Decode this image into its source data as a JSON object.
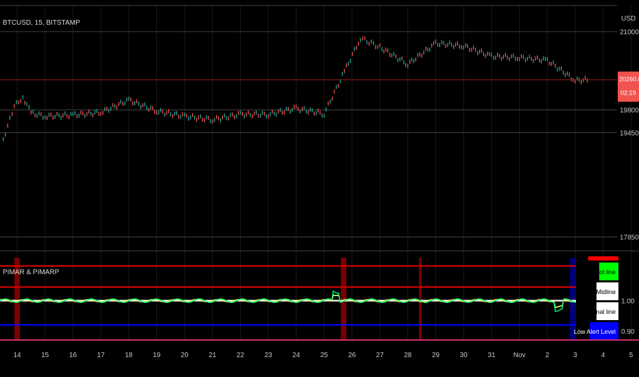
{
  "chart_data": [
    {
      "type": "candlestick",
      "title": "BTCUSD, 15, BITSTAMP",
      "ylabel": "USD",
      "x_ticks": [
        "14",
        "15",
        "16",
        "17",
        "18",
        "19",
        "20",
        "21",
        "22",
        "23",
        "24",
        "25",
        "26",
        "27",
        "28",
        "29",
        "30",
        "31",
        "Nov",
        "2",
        "3",
        "4",
        "5"
      ],
      "y_ticks": [
        21000.0,
        19800.0,
        19450.0,
        17850.0
      ],
      "ylim": [
        17700,
        21400
      ],
      "grid": true,
      "last_price": {
        "label": "20260.00",
        "countdown": "02:19",
        "color": "#f05350"
      },
      "series": [
        {
          "x": "13.5",
          "y": 19350
        },
        {
          "x": "13.9",
          "y": 19850
        },
        {
          "x": "14.2",
          "y": 20000
        },
        {
          "x": "14.5",
          "y": 19750
        },
        {
          "x": "15",
          "y": 19700
        },
        {
          "x": "16",
          "y": 19720
        },
        {
          "x": "17",
          "y": 19760
        },
        {
          "x": "18",
          "y": 19950
        },
        {
          "x": "19",
          "y": 19780
        },
        {
          "x": "20",
          "y": 19700
        },
        {
          "x": "21",
          "y": 19650
        },
        {
          "x": "22",
          "y": 19730
        },
        {
          "x": "23",
          "y": 19730
        },
        {
          "x": "24",
          "y": 19820
        },
        {
          "x": "25",
          "y": 19740
        },
        {
          "x": "25.8",
          "y": 20450
        },
        {
          "x": "26.3",
          "y": 20900
        },
        {
          "x": "27",
          "y": 20760
        },
        {
          "x": "28",
          "y": 20500
        },
        {
          "x": "29",
          "y": 20820
        },
        {
          "x": "30",
          "y": 20780
        },
        {
          "x": "31",
          "y": 20620
        },
        {
          "x": "Nov",
          "y": 20600
        },
        {
          "x": "2",
          "y": 20560
        },
        {
          "x": "3",
          "y": 20250
        },
        {
          "x": "3.5",
          "y": 20260
        }
      ],
      "colors": {
        "up": "#26a69a",
        "down": "#ef5350"
      }
    },
    {
      "type": "line",
      "title": "PIMAR & PIMARP",
      "y_ticks": [
        1.0,
        0.9
      ],
      "legend": [
        "Plot line",
        "Midline",
        "Signal line",
        "Low Alert Level"
      ],
      "legend_colors": [
        "#00ff00",
        "#ffffff",
        "#ffffff",
        "#0000ff"
      ],
      "legend_text_colors": [
        "#000000",
        "#000000",
        "#000000",
        "#ffffff"
      ],
      "legend_placement": "right",
      "levels": {
        "high_alert": 1.045,
        "mid": 1.0,
        "low_alert": 0.92
      },
      "level_colors": {
        "high_alert": "#d00000",
        "mid": "#ffffff",
        "low_alert": "#0000ff"
      },
      "red_highlights": [
        "13.9-14.1",
        "25.6-25.8",
        "28.4-28.5"
      ],
      "blue_highlights": [
        "2.8-3.0"
      ],
      "series": [
        {
          "name": "Plot line",
          "color": "#00e676"
        },
        {
          "name": "Signal line",
          "color": "#ffff66"
        }
      ]
    }
  ]
}
